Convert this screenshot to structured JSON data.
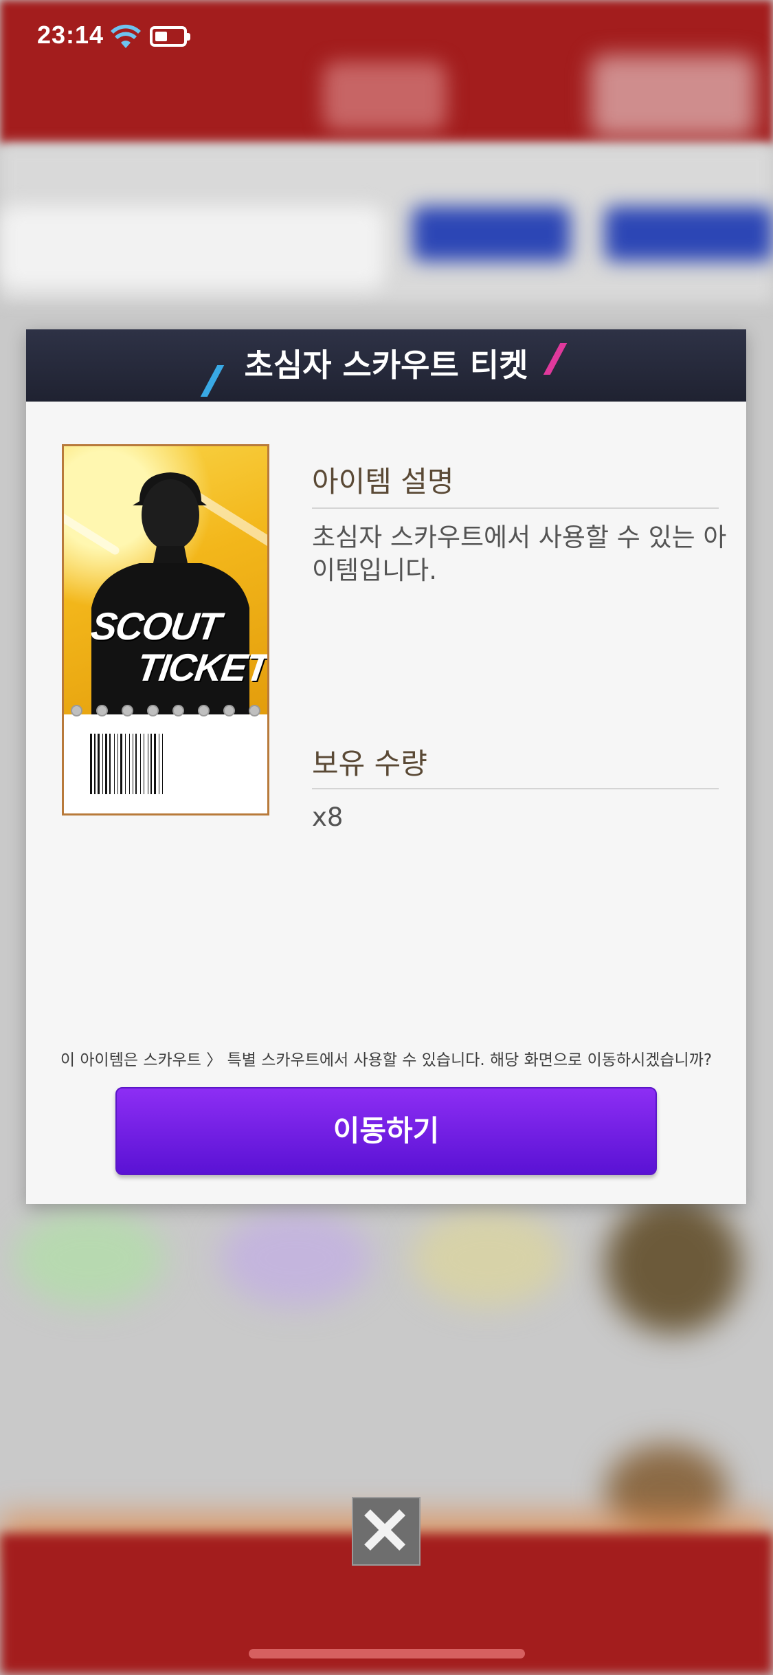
{
  "status_bar": {
    "time": "23:14",
    "battery_level": 0.45,
    "wifi_icon": "wifi-icon",
    "battery_icon": "battery-icon"
  },
  "dialog": {
    "title": "초심자 스카우트 티켓",
    "item_image_text": {
      "line1": "SCOUT",
      "line2": "TICKET"
    },
    "description_label": "아이템 설명",
    "description_text": "초심자 스카우트에서 사용할 수 있는 아이템입니다.",
    "quantity_label": "보유 수량",
    "quantity_value": "x8",
    "notice": "이 아이템은 스카우트 〉 특별 스카우트에서 사용할 수 있습니다. 해당 화면으로 이동하시겠습니까?",
    "move_button_label": "이동하기"
  },
  "close_icon": "close-icon",
  "colors": {
    "header_bg": "#262a3b",
    "accent_purple": "#7a22e8",
    "accent_blue_slash": "#39a9e5",
    "accent_pink_slash": "#e0399c",
    "background_red": "#a31d1d",
    "label_brown": "#5a4935"
  }
}
